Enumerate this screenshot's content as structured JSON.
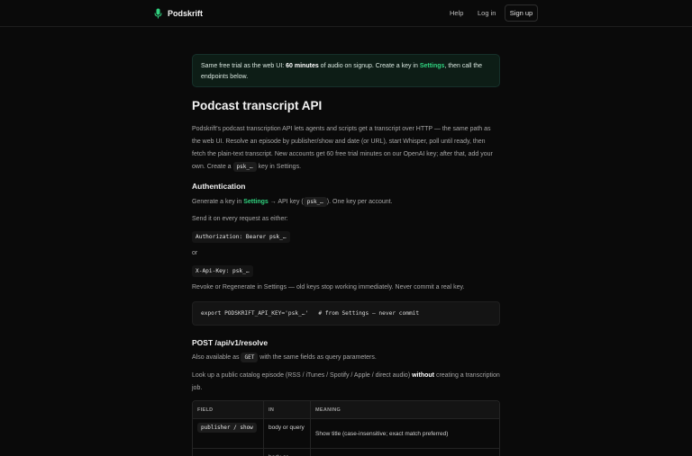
{
  "header": {
    "brand": "Podskrift",
    "nav": {
      "help": "Help",
      "login": "Log in",
      "signup": "Sign up"
    }
  },
  "notice": {
    "part1": "Same free trial as the web UI: ",
    "bold": "60 minutes",
    "part2": " of audio on signup. Create a key in ",
    "link": "Settings",
    "part3": ", then call the endpoints below."
  },
  "page": {
    "title": "Podcast transcript API",
    "intro_pre": "Podskrift's podcast transcription API lets agents and scripts get a transcript over HTTP — the same path as the web UI. Resolve an episode by publisher/show and date (or URL), start Whisper, poll until ready, then fetch the plain-text transcript. New accounts get 60 free trial minutes on our OpenAI key; after that, add your own. Create a ",
    "intro_code": "psk_…",
    "intro_post": " key in Settings."
  },
  "auth": {
    "heading": "Authentication",
    "gen_pre": "Generate a key in ",
    "gen_link": "Settings",
    "gen_mid": " → API key (",
    "gen_code": "psk_…",
    "gen_post": "). One key per account.",
    "send": "Send it on every request as either:",
    "header1": "Authorization: Bearer psk_…",
    "or": "or",
    "header2": "X-Api-Key: psk_…",
    "revoke": "Revoke or Regenerate in Settings — old keys stop working immediately. Never commit a real key.",
    "export": "export PODSKRIFT_API_KEY='psk_…'   # from Settings — never commit"
  },
  "resolve": {
    "heading": "POST /api/v1/resolve",
    "also_pre": "Also available as ",
    "also_code": "GET",
    "also_post": " with the same fields as query parameters.",
    "lookup_pre": "Look up a public catalog episode (RSS / iTunes / Spotify / Apple / direct audio) ",
    "lookup_bold": "without",
    "lookup_post": " creating a transcription job.",
    "table": {
      "headers": [
        "FIELD",
        "IN",
        "MEANING"
      ],
      "rows": [
        {
          "field": "publisher / show",
          "in": "body or query",
          "meaning": "Show title (case-insensitive; exact match preferred)"
        },
        {
          "field": "",
          "in": "body or",
          "meaning": ""
        }
      ]
    }
  }
}
